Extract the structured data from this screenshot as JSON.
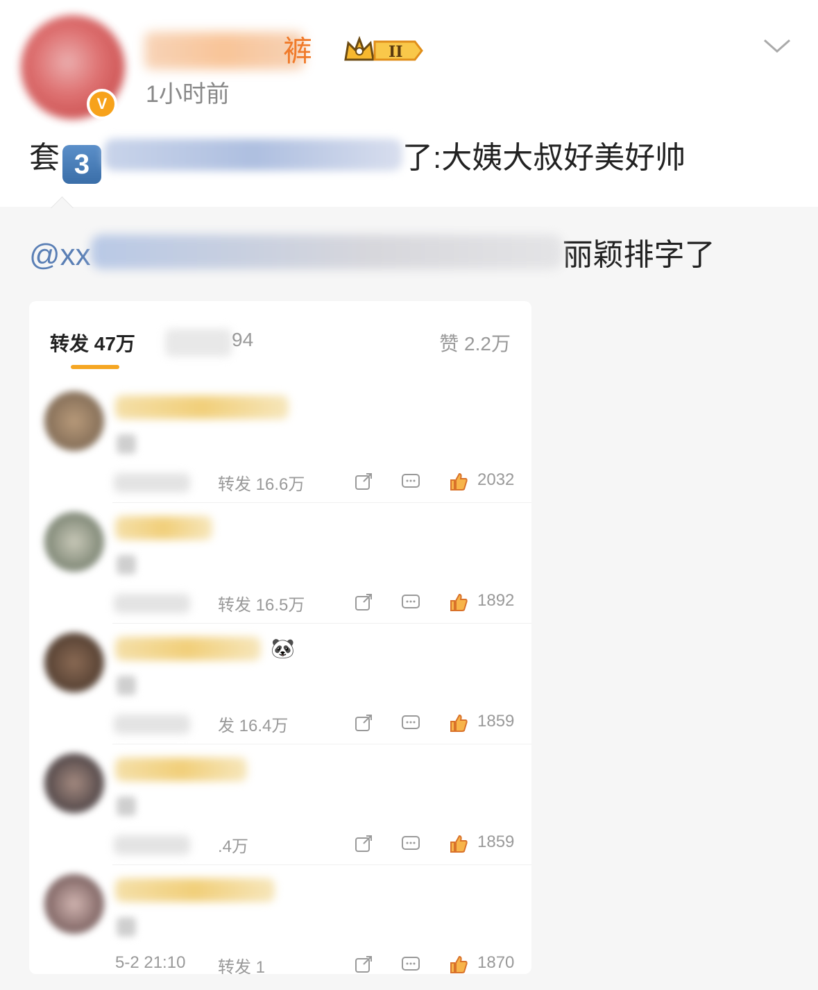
{
  "post": {
    "username_tail": "裤",
    "vip_level": "II",
    "verified_mark": "V",
    "time": "1小时前",
    "text_prefix": "套",
    "text_emoji": "3",
    "text_middle": "了",
    "text_suffix": ":大姨大叔好美好帅",
    "repost_prefix": "@xx",
    "repost_suffix": "丽颖排字了"
  },
  "card": {
    "tab_repost": "转发 47万",
    "tab_comment_tail": "94",
    "tab_like": "赞 2.2万",
    "rows": [
      {
        "repost": "转发 16.6万",
        "likes": "2032",
        "date": ""
      },
      {
        "repost": "转发 16.5万",
        "likes": "1892",
        "date": ""
      },
      {
        "repost": "发 16.4万",
        "likes": "1859",
        "date": ""
      },
      {
        "repost": ".4万",
        "likes": "1859",
        "date": ""
      },
      {
        "repost": "转发 1",
        "likes": "1870",
        "date": "5-2 21:10"
      }
    ]
  },
  "icons": {
    "chevron": "chevron-down-icon",
    "share": "share-icon",
    "comment": "comment-icon",
    "like": "thumbs-up-icon",
    "panda": "panda-emoji"
  },
  "colors": {
    "accent": "#f5a623",
    "username": "#f07a2a",
    "mention": "#5a7fb5",
    "like_icon": "#f07a2a"
  }
}
